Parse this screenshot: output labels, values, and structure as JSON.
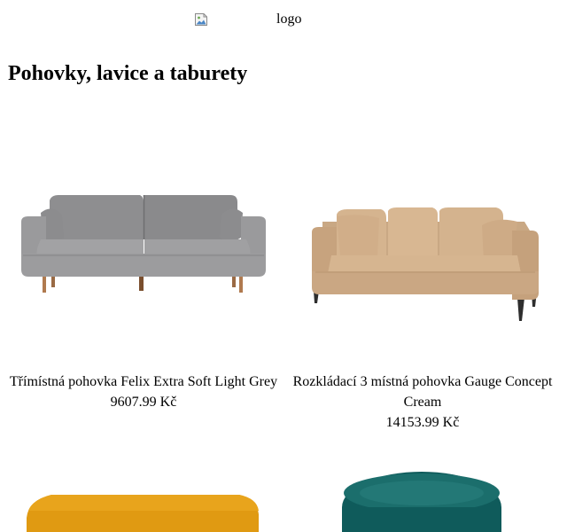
{
  "header": {
    "logo_alt": "logo"
  },
  "page": {
    "title": "Pohovky, lavice a taburety"
  },
  "products": [
    {
      "name": "Třímístná pohovka Felix Extra Soft Light Grey",
      "price": "9607.99 Kč",
      "image": "grey-sofa"
    },
    {
      "name": "Rozkládací 3 místná pohovka Gauge Concept Cream",
      "price": "14153.99 Kč",
      "image": "cream-sofa"
    },
    {
      "image": "mustard-ottoman"
    },
    {
      "image": "teal-round-pouf"
    }
  ]
}
